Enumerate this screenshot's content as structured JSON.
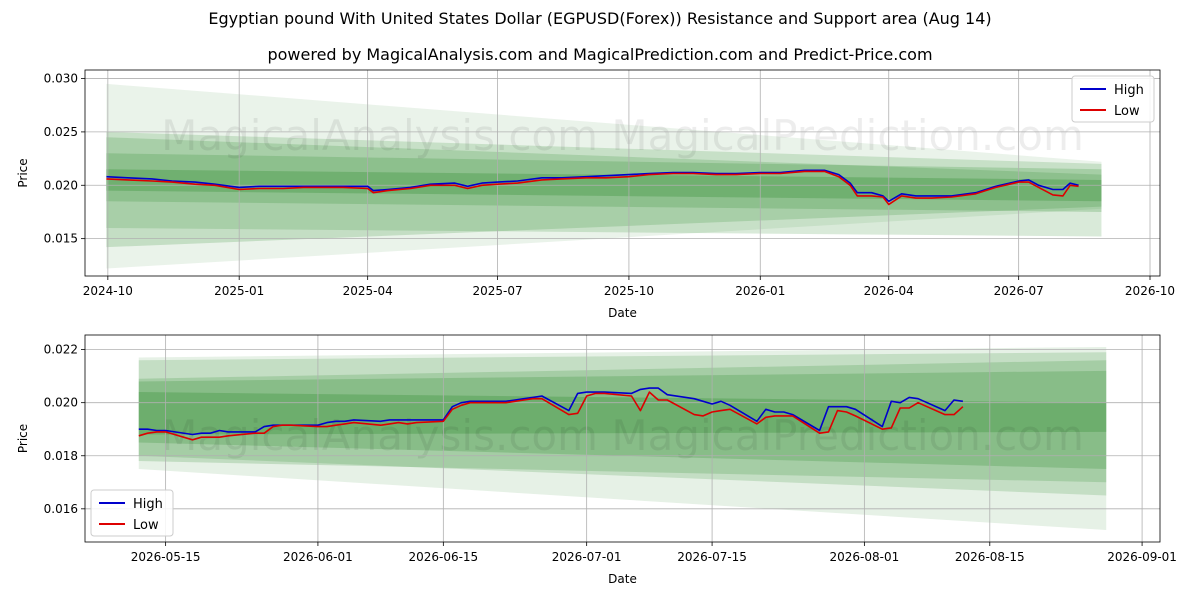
{
  "title": "Egyptian pound With United States Dollar (EGPUSD(Forex)) Resistance and Support area (Aug 14)",
  "subtitle": "powered by MagicalAnalysis.com and MagicalPrediction.com and Predict-Price.com",
  "watermark": "MagicalAnalysis.com    MagicalPrediction.com",
  "colors": {
    "high": "#0000cc",
    "low": "#dd0000",
    "band": "#2e8b2e",
    "grid": "#b0b0b0"
  },
  "chart_data": [
    {
      "type": "line",
      "xlabel": "Date",
      "ylabel": "Price",
      "xlim": [
        "2024-09-15",
        "2026-10-08"
      ],
      "ylim": [
        0.0115,
        0.0308
      ],
      "x_ticks": [
        "2024-10",
        "2025-01",
        "2025-04",
        "2025-07",
        "2025-10",
        "2026-01",
        "2026-04",
        "2026-07",
        "2026-10"
      ],
      "y_ticks": [
        "0.015",
        "0.020",
        "0.025",
        "0.030"
      ],
      "grid": true,
      "legend_position": "top-right",
      "legend": [
        "High",
        "Low"
      ],
      "series": [
        {
          "name": "High",
          "x": [
            "2024-09-30",
            "2024-10-15",
            "2024-11-01",
            "2024-11-15",
            "2024-12-01",
            "2024-12-15",
            "2025-01-01",
            "2025-01-15",
            "2025-02-01",
            "2025-02-15",
            "2025-03-01",
            "2025-03-15",
            "2025-04-01",
            "2025-04-05",
            "2025-04-15",
            "2025-05-01",
            "2025-05-15",
            "2025-06-01",
            "2025-06-10",
            "2025-06-20",
            "2025-07-01",
            "2025-07-15",
            "2025-08-01",
            "2025-08-15",
            "2025-09-01",
            "2025-09-15",
            "2025-10-01",
            "2025-10-15",
            "2025-11-01",
            "2025-11-15",
            "2025-12-01",
            "2025-12-15",
            "2026-01-01",
            "2026-01-15",
            "2026-02-01",
            "2026-02-15",
            "2026-02-25",
            "2026-03-05",
            "2026-03-10",
            "2026-03-20",
            "2026-03-28",
            "2026-04-01",
            "2026-04-10",
            "2026-04-20",
            "2026-05-01",
            "2026-05-15",
            "2026-06-01",
            "2026-06-15",
            "2026-07-01",
            "2026-07-08",
            "2026-07-15",
            "2026-07-25",
            "2026-08-01",
            "2026-08-06",
            "2026-08-12"
          ],
          "values": [
            0.0208,
            0.0207,
            0.0206,
            0.0204,
            0.0203,
            0.0201,
            0.0198,
            0.0199,
            0.0199,
            0.0199,
            0.0199,
            0.0199,
            0.0199,
            0.0195,
            0.0196,
            0.0198,
            0.0201,
            0.0202,
            0.0199,
            0.0202,
            0.0203,
            0.0204,
            0.0207,
            0.0207,
            0.0208,
            0.0209,
            0.021,
            0.0211,
            0.0212,
            0.0212,
            0.0211,
            0.0211,
            0.0212,
            0.0212,
            0.0214,
            0.0214,
            0.021,
            0.0202,
            0.0193,
            0.0193,
            0.019,
            0.0185,
            0.0192,
            0.019,
            0.019,
            0.019,
            0.0193,
            0.0199,
            0.0204,
            0.0205,
            0.02,
            0.0196,
            0.0196,
            0.0202,
            0.02
          ]
        },
        {
          "name": "Low",
          "x": [
            "2024-09-30",
            "2024-10-15",
            "2024-11-01",
            "2024-11-15",
            "2024-12-01",
            "2024-12-15",
            "2025-01-01",
            "2025-01-15",
            "2025-02-01",
            "2025-02-15",
            "2025-03-01",
            "2025-03-15",
            "2025-04-01",
            "2025-04-05",
            "2025-04-15",
            "2025-05-01",
            "2025-05-15",
            "2025-06-01",
            "2025-06-10",
            "2025-06-20",
            "2025-07-01",
            "2025-07-15",
            "2025-08-01",
            "2025-08-15",
            "2025-09-01",
            "2025-09-15",
            "2025-10-01",
            "2025-10-15",
            "2025-11-01",
            "2025-11-15",
            "2025-12-01",
            "2025-12-15",
            "2026-01-01",
            "2026-01-15",
            "2026-02-01",
            "2026-02-15",
            "2026-02-25",
            "2026-03-05",
            "2026-03-10",
            "2026-03-20",
            "2026-03-28",
            "2026-04-01",
            "2026-04-10",
            "2026-04-20",
            "2026-05-01",
            "2026-05-15",
            "2026-06-01",
            "2026-06-15",
            "2026-07-01",
            "2026-07-08",
            "2026-07-15",
            "2026-07-25",
            "2026-08-01",
            "2026-08-06",
            "2026-08-12"
          ],
          "values": [
            0.0206,
            0.0205,
            0.0204,
            0.0203,
            0.0201,
            0.02,
            0.0196,
            0.0197,
            0.0197,
            0.0198,
            0.0198,
            0.0198,
            0.0197,
            0.0193,
            0.0195,
            0.0197,
            0.02,
            0.02,
            0.0197,
            0.02,
            0.0201,
            0.0202,
            0.0205,
            0.0206,
            0.0207,
            0.0207,
            0.0208,
            0.021,
            0.0211,
            0.0211,
            0.021,
            0.021,
            0.0211,
            0.0211,
            0.0213,
            0.0213,
            0.0208,
            0.02,
            0.019,
            0.019,
            0.0189,
            0.0182,
            0.019,
            0.0188,
            0.0188,
            0.0189,
            0.0192,
            0.0198,
            0.0203,
            0.0203,
            0.0198,
            0.0191,
            0.019,
            0.02,
            0.0199
          ]
        }
      ],
      "bands": [
        {
          "x0": "2024-09-30",
          "x1": "2026-08-28",
          "y0_top": 0.0295,
          "y0_bottom": 0.0122,
          "y1_top": 0.0222,
          "y1_bottom": 0.0178,
          "opacity": 0.1
        },
        {
          "x0": "2024-09-30",
          "x1": "2026-08-28",
          "y0_top": 0.025,
          "y0_bottom": 0.016,
          "y1_top": 0.022,
          "y1_bottom": 0.0152,
          "opacity": 0.18
        },
        {
          "x0": "2024-09-30",
          "x1": "2026-08-28",
          "y0_top": 0.0245,
          "y0_bottom": 0.0142,
          "y1_top": 0.021,
          "y1_bottom": 0.018,
          "opacity": 0.2
        },
        {
          "x0": "2024-09-30",
          "x1": "2026-08-28",
          "y0_top": 0.023,
          "y0_bottom": 0.0185,
          "y1_top": 0.0215,
          "y1_bottom": 0.0175,
          "opacity": 0.22
        },
        {
          "x0": "2024-09-30",
          "x1": "2026-08-28",
          "y0_top": 0.0215,
          "y0_bottom": 0.0195,
          "y1_top": 0.0205,
          "y1_bottom": 0.0185,
          "opacity": 0.3
        }
      ]
    },
    {
      "type": "line",
      "xlabel": "Date",
      "ylabel": "Price",
      "xlim": [
        "2026-05-06",
        "2026-09-03"
      ],
      "ylim": [
        0.01475,
        0.02255
      ],
      "x_ticks": [
        "2026-05-15",
        "2026-06-01",
        "2026-06-15",
        "2026-07-01",
        "2026-07-15",
        "2026-08-01",
        "2026-08-15",
        "2026-09-01"
      ],
      "y_ticks": [
        "0.016",
        "0.018",
        "0.020",
        "0.022"
      ],
      "grid": true,
      "legend_position": "bottom-left",
      "legend": [
        "High",
        "Low"
      ],
      "series": [
        {
          "name": "High",
          "x": [
            "2026-05-12",
            "2026-05-13",
            "2026-05-14",
            "2026-05-15",
            "2026-05-18",
            "2026-05-19",
            "2026-05-20",
            "2026-05-21",
            "2026-05-22",
            "2026-05-25",
            "2026-05-26",
            "2026-05-27",
            "2026-05-28",
            "2026-05-29",
            "2026-06-01",
            "2026-06-02",
            "2026-06-03",
            "2026-06-04",
            "2026-06-05",
            "2026-06-08",
            "2026-06-09",
            "2026-06-10",
            "2026-06-11",
            "2026-06-12",
            "2026-06-15",
            "2026-06-16",
            "2026-06-17",
            "2026-06-18",
            "2026-06-19",
            "2026-06-22",
            "2026-06-23",
            "2026-06-24",
            "2026-06-25",
            "2026-06-26",
            "2026-06-29",
            "2026-06-30",
            "2026-07-01",
            "2026-07-02",
            "2026-07-03",
            "2026-07-06",
            "2026-07-07",
            "2026-07-08",
            "2026-07-09",
            "2026-07-10",
            "2026-07-13",
            "2026-07-14",
            "2026-07-15",
            "2026-07-16",
            "2026-07-17",
            "2026-07-20",
            "2026-07-21",
            "2026-07-22",
            "2026-07-23",
            "2026-07-24",
            "2026-07-27",
            "2026-07-28",
            "2026-07-29",
            "2026-07-30",
            "2026-07-31",
            "2026-08-03",
            "2026-08-04",
            "2026-08-05",
            "2026-08-06",
            "2026-08-07",
            "2026-08-10",
            "2026-08-11",
            "2026-08-12"
          ],
          "values": [
            0.019,
            0.019,
            0.01895,
            0.01895,
            0.0188,
            0.01885,
            0.01885,
            0.01895,
            0.0189,
            0.0189,
            0.0191,
            0.01915,
            0.01915,
            0.01915,
            0.01915,
            0.01925,
            0.0193,
            0.0193,
            0.01935,
            0.0193,
            0.01935,
            0.01935,
            0.01935,
            0.01935,
            0.01935,
            0.01985,
            0.02,
            0.02005,
            0.02005,
            0.02005,
            0.0201,
            0.02015,
            0.0202,
            0.02025,
            0.0197,
            0.02035,
            0.0204,
            0.0204,
            0.0204,
            0.02035,
            0.0205,
            0.02055,
            0.02055,
            0.0203,
            0.02015,
            0.02005,
            0.01995,
            0.02005,
            0.0199,
            0.0193,
            0.01975,
            0.01965,
            0.01965,
            0.01955,
            0.01895,
            0.01985,
            0.01985,
            0.01985,
            0.01975,
            0.0191,
            0.02005,
            0.02,
            0.0202,
            0.02015,
            0.0197,
            0.0201,
            0.02005
          ]
        },
        {
          "name": "Low",
          "x": [
            "2026-05-12",
            "2026-05-13",
            "2026-05-14",
            "2026-05-15",
            "2026-05-18",
            "2026-05-19",
            "2026-05-20",
            "2026-05-21",
            "2026-05-22",
            "2026-05-25",
            "2026-05-26",
            "2026-05-27",
            "2026-05-28",
            "2026-05-29",
            "2026-06-01",
            "2026-06-02",
            "2026-06-03",
            "2026-06-04",
            "2026-06-05",
            "2026-06-08",
            "2026-06-09",
            "2026-06-10",
            "2026-06-11",
            "2026-06-12",
            "2026-06-15",
            "2026-06-16",
            "2026-06-17",
            "2026-06-18",
            "2026-06-19",
            "2026-06-22",
            "2026-06-23",
            "2026-06-24",
            "2026-06-25",
            "2026-06-26",
            "2026-06-29",
            "2026-06-30",
            "2026-07-01",
            "2026-07-02",
            "2026-07-03",
            "2026-07-06",
            "2026-07-07",
            "2026-07-08",
            "2026-07-09",
            "2026-07-10",
            "2026-07-13",
            "2026-07-14",
            "2026-07-15",
            "2026-07-16",
            "2026-07-17",
            "2026-07-20",
            "2026-07-21",
            "2026-07-22",
            "2026-07-23",
            "2026-07-24",
            "2026-07-27",
            "2026-07-28",
            "2026-07-29",
            "2026-07-30",
            "2026-07-31",
            "2026-08-03",
            "2026-08-04",
            "2026-08-05",
            "2026-08-06",
            "2026-08-07",
            "2026-08-10",
            "2026-08-11",
            "2026-08-12"
          ],
          "values": [
            0.01875,
            0.01885,
            0.0189,
            0.0189,
            0.0186,
            0.0187,
            0.0187,
            0.0187,
            0.01875,
            0.01885,
            0.01885,
            0.0191,
            0.01915,
            0.01915,
            0.0191,
            0.0191,
            0.01915,
            0.0192,
            0.01925,
            0.01915,
            0.0192,
            0.01925,
            0.0192,
            0.01925,
            0.0193,
            0.01975,
            0.0199,
            0.02,
            0.02,
            0.02,
            0.02005,
            0.0201,
            0.02015,
            0.02015,
            0.01955,
            0.0196,
            0.02025,
            0.02035,
            0.02035,
            0.02025,
            0.0197,
            0.0204,
            0.0201,
            0.0201,
            0.01955,
            0.0195,
            0.01965,
            0.0197,
            0.01975,
            0.0192,
            0.01945,
            0.0195,
            0.0195,
            0.0195,
            0.01885,
            0.0189,
            0.0197,
            0.01965,
            0.0195,
            0.019,
            0.01905,
            0.0198,
            0.0198,
            0.02,
            0.01955,
            0.01955,
            0.01985
          ]
        }
      ],
      "bands": [
        {
          "x0": "2026-05-12",
          "x1": "2026-08-28",
          "y0_top": 0.0217,
          "y0_bottom": 0.0175,
          "y1_top": 0.0221,
          "y1_bottom": 0.0152,
          "opacity": 0.12
        },
        {
          "x0": "2026-05-12",
          "x1": "2026-08-28",
          "y0_top": 0.0216,
          "y0_bottom": 0.018,
          "y1_top": 0.0219,
          "y1_bottom": 0.0165,
          "opacity": 0.18
        },
        {
          "x0": "2026-05-12",
          "x1": "2026-08-28",
          "y0_top": 0.0209,
          "y0_bottom": 0.0178,
          "y1_top": 0.0216,
          "y1_bottom": 0.017,
          "opacity": 0.2
        },
        {
          "x0": "2026-05-12",
          "x1": "2026-08-28",
          "y0_top": 0.0208,
          "y0_bottom": 0.0185,
          "y1_top": 0.0212,
          "y1_bottom": 0.0175,
          "opacity": 0.24
        },
        {
          "x0": "2026-05-12",
          "x1": "2026-08-28",
          "y0_top": 0.0204,
          "y0_bottom": 0.0188,
          "y1_top": 0.02,
          "y1_bottom": 0.0189,
          "opacity": 0.3
        }
      ]
    }
  ]
}
